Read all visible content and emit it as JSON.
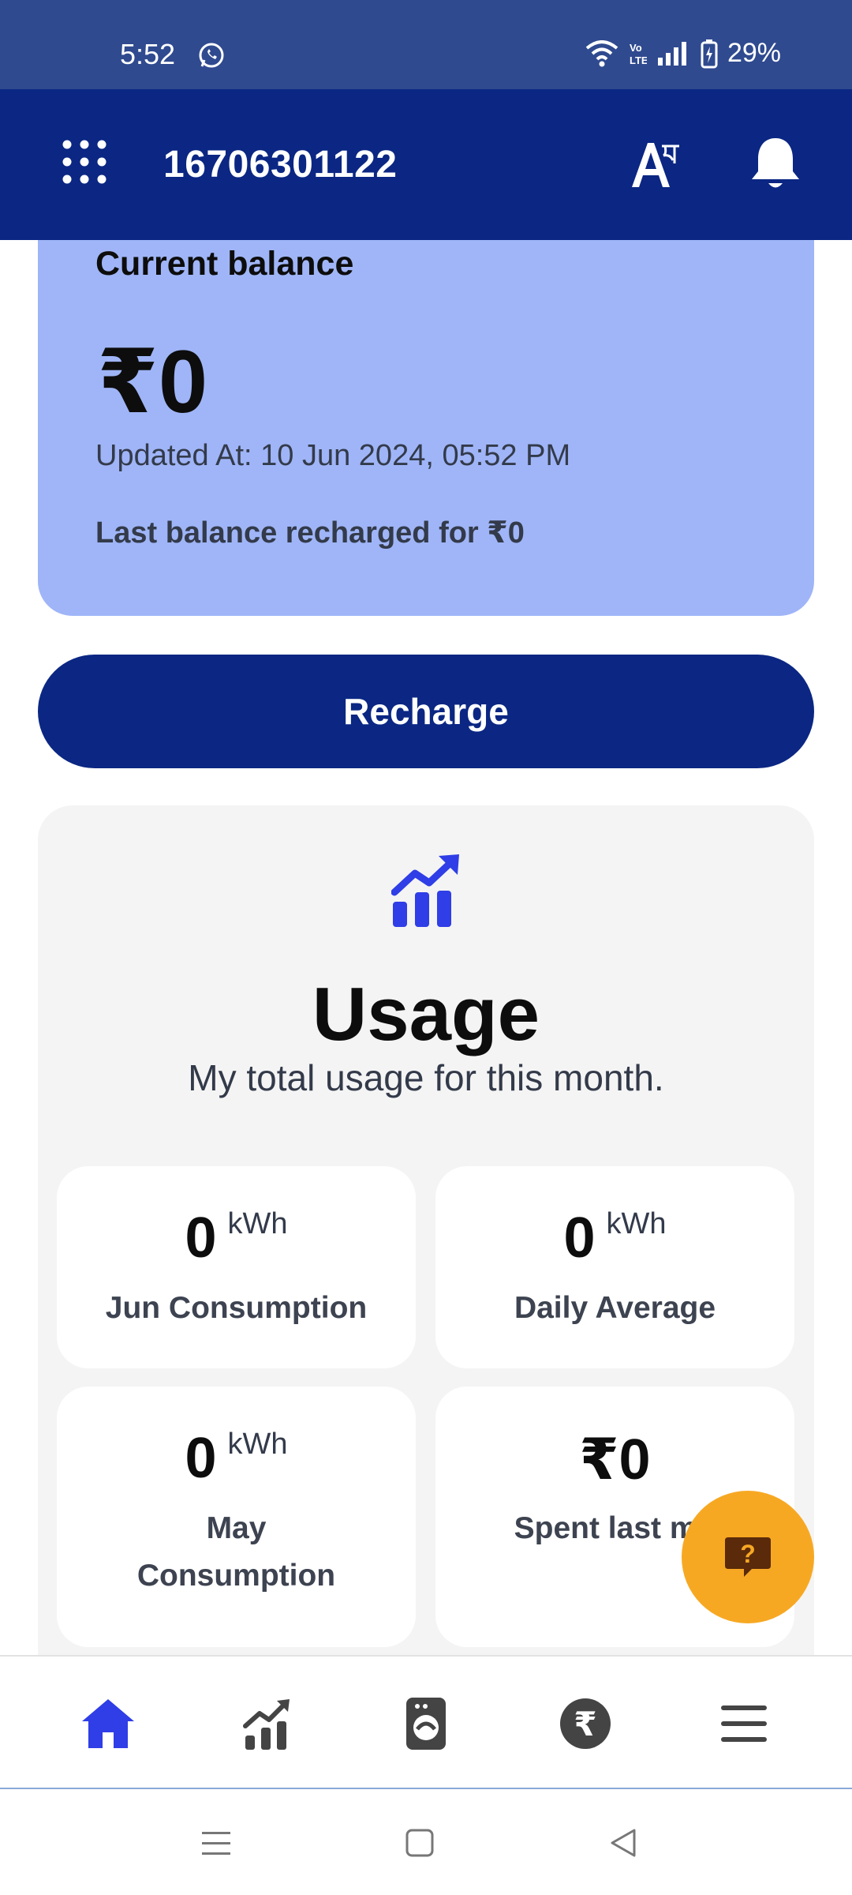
{
  "status_bar": {
    "time": "5:52",
    "battery": "29%",
    "icons": [
      "whatsapp-icon",
      "wifi-icon",
      "volte-icon",
      "signal-icon",
      "battery-charging-icon"
    ]
  },
  "header": {
    "account_number": "16706301122",
    "menu_icon": "grid-menu-icon",
    "language_icon": "language-toggle-icon",
    "notification_icon": "bell-icon",
    "background": "#0b2783"
  },
  "balance": {
    "title": "Current balance",
    "amount": "₹0",
    "updated_at": "Updated At: 10 Jun 2024, 05:52 PM",
    "last_recharge": "Last balance recharged for ₹0",
    "background": "#9fb5f7"
  },
  "recharge_button": {
    "label": "Recharge"
  },
  "usage": {
    "icon": "trending-chart-icon",
    "title": "Usage",
    "subtitle": "My total usage for this month.",
    "stats": [
      {
        "value": "0",
        "unit": "kWh",
        "label": "Jun Consumption"
      },
      {
        "value": "0",
        "unit": "kWh",
        "label": "Daily Average"
      },
      {
        "value": "0",
        "unit": "kWh",
        "label": "May Consumption"
      },
      {
        "value": "₹0",
        "unit": "",
        "label": "Spent last mo"
      }
    ]
  },
  "help_fab": {
    "icon": "help-chat-icon",
    "color": "#f7a823"
  },
  "bottom_nav": {
    "items": [
      {
        "icon": "home-icon",
        "active": true
      },
      {
        "icon": "usage-chart-icon",
        "active": false
      },
      {
        "icon": "meter-icon",
        "active": false
      },
      {
        "icon": "rupee-icon",
        "active": false
      },
      {
        "icon": "hamburger-menu-icon",
        "active": false
      }
    ],
    "active_color": "#2f3ee6",
    "inactive_color": "#444444"
  },
  "system_nav": [
    "recents-icon",
    "home-square-icon",
    "back-icon"
  ]
}
